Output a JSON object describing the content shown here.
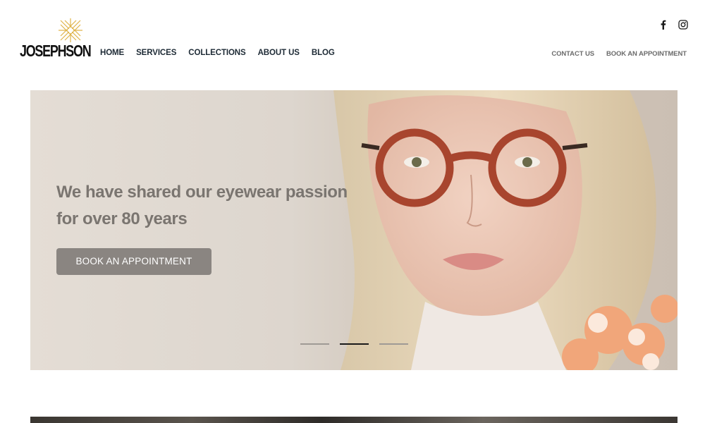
{
  "brand": {
    "name": "JOSEPHSON"
  },
  "nav": {
    "items": [
      {
        "label": "HOME"
      },
      {
        "label": "SERVICES"
      },
      {
        "label": "COLLECTIONS"
      },
      {
        "label": "ABOUT US"
      },
      {
        "label": "BLOG"
      }
    ]
  },
  "utility_nav": {
    "contact_label": "CONTACT US",
    "appointment_label": "BOOK AN APPOINTMENT"
  },
  "social": {
    "icons": [
      "facebook-icon",
      "instagram-icon"
    ]
  },
  "hero": {
    "heading": "We have shared our eyewear passion for over 80 years",
    "cta_label": "BOOK AN APPOINTMENT",
    "slides_total": 3,
    "active_slide": 2
  },
  "colors": {
    "nav_text": "#1d2a35",
    "utility_text": "#6b6b6b",
    "hero_text": "#7a7570",
    "cta_bg": "#8a8581",
    "logo_accent": "#e0b44a"
  }
}
